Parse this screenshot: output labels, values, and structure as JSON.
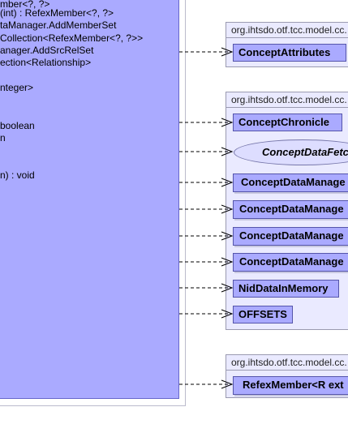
{
  "class_members": [
    "mber<?, ?>",
    "(int) : RefexMember<?, ?>",
    "taManager.AddMemberSet",
    "Collection<RefexMember<?, ?>>",
    "anager.AddSrcRelSet",
    "ection<Relationship>",
    "nteger>",
    "boolean",
    "n",
    "n) : void"
  ],
  "packages": [
    {
      "title": "org.ihtsdo.otf.tcc.model.cc.",
      "nodes": [
        "ConceptAttributes"
      ]
    },
    {
      "title": "org.ihtsdo.otf.tcc.model.cc.",
      "nodes": [
        "ConceptChronicle",
        "ConceptDataFetch",
        "ConceptDataManage",
        "ConceptDataManage",
        "ConceptDataManage",
        "ConceptDataManage",
        "NidDataInMemory",
        "OFFSETS"
      ]
    },
    {
      "title": "org.ihtsdo.otf.tcc.model.cc.",
      "nodes": [
        "RefexMember<R ext"
      ]
    }
  ]
}
